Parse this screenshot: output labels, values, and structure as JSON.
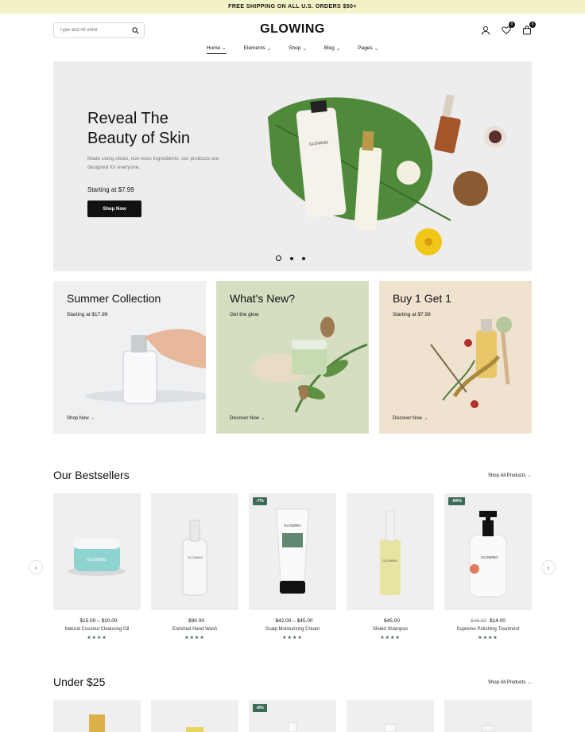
{
  "promo": {
    "text": "FREE SHIPPING ON ALL U.S. ORDERS $50+"
  },
  "header": {
    "search_placeholder": "Type and hit enter",
    "logo": "GLOWING",
    "wishlist_count": "0",
    "cart_count": "0"
  },
  "nav": [
    {
      "label": "Home"
    },
    {
      "label": "Elements"
    },
    {
      "label": "Shop"
    },
    {
      "label": "Blog"
    },
    {
      "label": "Pages"
    }
  ],
  "hero": {
    "title_line1": "Reveal The",
    "title_line2": "Beauty of Skin",
    "description": "Made using clean, non-toxic ingredients, our products are designed for everyone.",
    "price": "Starting at $7.99",
    "button": "Shop Now",
    "slides": 3,
    "active_slide": 1
  },
  "collections": [
    {
      "title": "Summer Collection",
      "subtitle": "Starting at $17.99",
      "link": "Shop Now →",
      "bg": "#eef0f2"
    },
    {
      "title": "What's New?",
      "subtitle": "Get the glow",
      "link": "Discover Now →",
      "bg": "#d6dec2"
    },
    {
      "title": "Buy 1 Get 1",
      "subtitle": "Starting at $7.99",
      "link": "Discover Now →",
      "bg": "#efe3cf"
    }
  ],
  "bestsellers": {
    "title": "Our Bestsellers",
    "link": "Shop All Products →",
    "products": [
      {
        "price": "$15.00 – $20.00",
        "old_price": "",
        "name": "Natural Coconut Cleansing Oil",
        "stars": "★★★★",
        "tag": ""
      },
      {
        "price": "$90.00",
        "old_price": "",
        "name": "Enriched Hand Wash",
        "stars": "★★★★",
        "tag": ""
      },
      {
        "price": "$42.00 – $45.00",
        "old_price": "",
        "name": "Scalp Moisturizing Cream",
        "stars": "★★★★",
        "tag": "-7%"
      },
      {
        "price": "$45.00",
        "old_price": "",
        "name": "Shield Shampoo",
        "stars": "★★★★",
        "tag": ""
      },
      {
        "price": "$14.00",
        "old_price": "$46.00",
        "name": "Supreme Polishing Treatment",
        "stars": "★★★★",
        "tag": "-69%"
      }
    ]
  },
  "under25": {
    "title": "Under $25",
    "link": "Shop All Products →",
    "tags": [
      "",
      "",
      "-8%",
      "",
      ""
    ]
  },
  "icons": {
    "prev": "‹",
    "next": "›",
    "chevron": "⌄"
  }
}
